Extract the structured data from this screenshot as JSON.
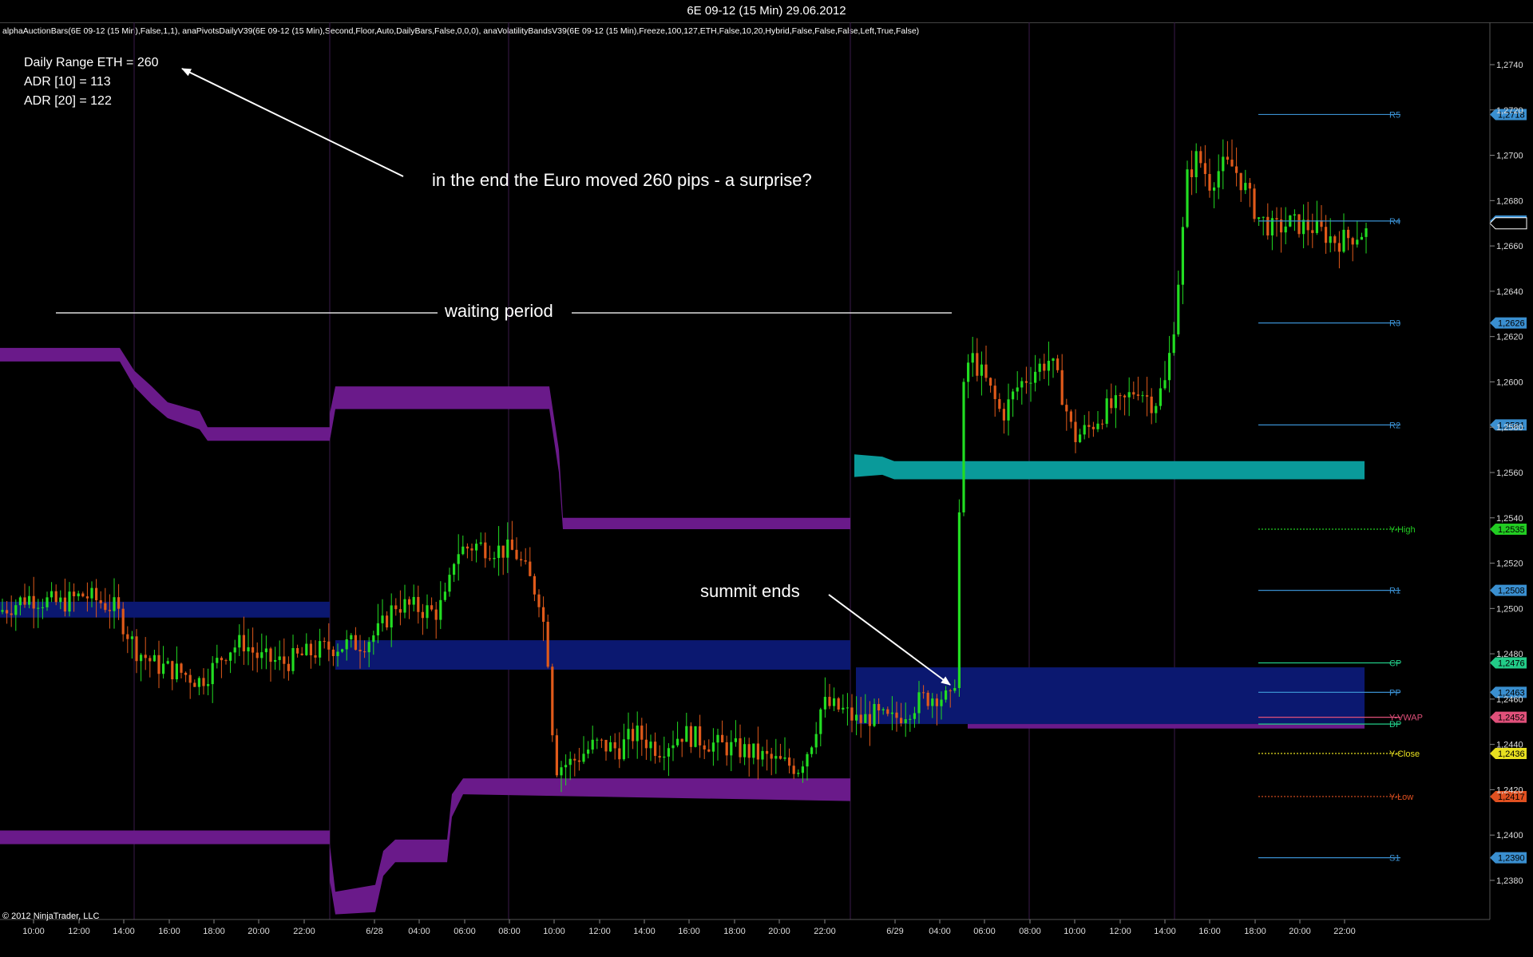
{
  "window": {
    "title": "6E 09-12 (15 Min)  29.06.2012",
    "indicators": "alphaAuctionBars(6E 09-12 (15 Min),False,1,1), anaPivotsDailyV39(6E 09-12 (15 Min),Second,Floor,Auto,DailyBars,False,0,0,0), anaVolatilityBandsV39(6E 09-12 (15 Min),Freeze,100,127,ETH,False,10,20,Hybrid,False,False,False,Left,True,False)",
    "copyright": "© 2012 NinjaTrader, LLC"
  },
  "info_box": {
    "daily_range": "Daily Range ETH = 260",
    "adr10": "ADR [10] = 113",
    "adr20": "ADR [20] = 122"
  },
  "annotations": {
    "surprise": "in the end the Euro moved 260 pips - a surprise?",
    "waiting": "waiting period",
    "summit": "summit ends"
  },
  "chart_data": {
    "type": "candlestick",
    "ylim": [
      1.2365,
      1.2755
    ],
    "y_ticks": [
      "1,2380",
      "1,2400",
      "1,2420",
      "1,2440",
      "1,2460",
      "1,2480",
      "1,2500",
      "1,2520",
      "1,2540",
      "1,2560",
      "1,2580",
      "1,2600",
      "1,2620",
      "1,2640",
      "1,2660",
      "1,2680",
      "1,2700",
      "1,2720",
      "1,2740"
    ],
    "x_ticks": [
      "10:00",
      "12:00",
      "14:00",
      "16:00",
      "18:00",
      "20:00",
      "22:00",
      "6/28",
      "04:00",
      "06:00",
      "08:00",
      "10:00",
      "12:00",
      "14:00",
      "16:00",
      "18:00",
      "20:00",
      "22:00",
      "6/29",
      "04:00",
      "06:00",
      "08:00",
      "10:00",
      "12:00",
      "14:00",
      "16:00",
      "18:00",
      "20:00",
      "22:00"
    ],
    "pivot_levels": [
      {
        "name": "R5",
        "value": 1.2718,
        "label": "1,2718",
        "color": "#3a8fd0"
      },
      {
        "name": "R4",
        "value": 1.2671,
        "label": "1,2670",
        "color": "#3a8fd0"
      },
      {
        "name": "R3",
        "value": 1.2626,
        "label": "1,2626",
        "color": "#3a8fd0"
      },
      {
        "name": "R2",
        "value": 1.2581,
        "label": "1,2581",
        "color": "#3a8fd0"
      },
      {
        "name": "Y-High",
        "value": 1.2535,
        "label": "1,2535",
        "color": "#22cc22"
      },
      {
        "name": "R1",
        "value": 1.2508,
        "label": "1,2508",
        "color": "#3a8fd0"
      },
      {
        "name": "CP",
        "value": 1.2476,
        "label": "1,2476",
        "color": "#22cc88"
      },
      {
        "name": "PP",
        "value": 1.2463,
        "label": "1,2463",
        "color": "#3a8fd0"
      },
      {
        "name": "Y-VWAP",
        "value": 1.2452,
        "label": "1,2452",
        "color": "#e0507a"
      },
      {
        "name": "DP",
        "value": 1.2449,
        "label": "",
        "color": "#22cc88"
      },
      {
        "name": "Y-Close",
        "value": 1.2436,
        "label": "1,2436",
        "color": "#e8e020"
      },
      {
        "name": "Y-Low",
        "value": 1.2417,
        "label": "1,2417",
        "color": "#e05020"
      },
      {
        "name": "S1",
        "value": 1.239,
        "label": "1,2390",
        "color": "#3a8fd0"
      }
    ]
  },
  "colors": {
    "up": "#22dd22",
    "down": "#e05a1a",
    "purple_band": "#6a1a8a",
    "navy_band": "#0b1870",
    "teal_band": "#0a9a9a",
    "grid": "#333333"
  }
}
